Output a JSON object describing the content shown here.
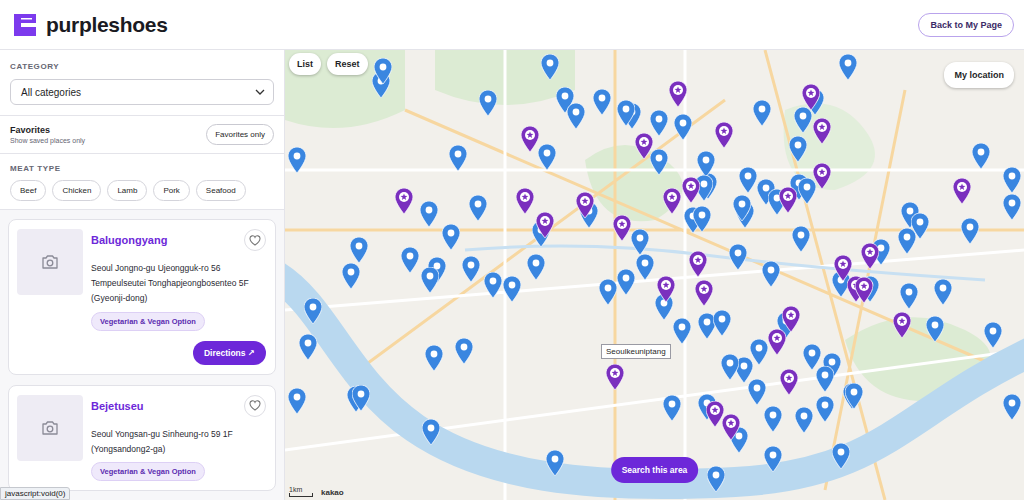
{
  "header": {
    "brand": "purpleshoes",
    "back_button": "Back to My Page"
  },
  "filters": {
    "category_label": "CATEGORY",
    "category_value": "All categories",
    "favorites_title": "Favorites",
    "favorites_hint": "Show saved places only",
    "favorites_button": "Favorites only",
    "favorites_only": false,
    "meat_type_label": "MEAT TYPE",
    "meat_types": [
      {
        "label": "Beef",
        "selected": false
      },
      {
        "label": "Chicken",
        "selected": false
      },
      {
        "label": "Lamb",
        "selected": false
      },
      {
        "label": "Pork",
        "selected": false
      },
      {
        "label": "Seafood",
        "selected": false
      }
    ]
  },
  "places": [
    {
      "name": "Balugongyang",
      "address": "Seoul Jongno-gu Ujeongguk-ro 56 Tempeulseutei Tonghapjeongbosenteo 5F (Gyeonji-dong)",
      "tag": "Vegetarian & Vegan Option",
      "favorite": false,
      "action": "Directions ↗"
    },
    {
      "name": "Bejetuseu",
      "address": "Seoul Yongsan-gu Sinheung-ro 59 1F (Yongsandong2-ga)",
      "tag": "Vegetarian & Vegan Option",
      "favorite": false
    }
  ],
  "map": {
    "buttons": [
      "List",
      "Reset"
    ],
    "my_location": "My location",
    "search_button": "Search this area",
    "scale": "1km",
    "attribution": "kakao",
    "tooltip": "Seoulkeuniptang",
    "pins": [
      {
        "kind": "standard",
        "color": "#3a86e0"
      },
      {
        "kind": "standard",
        "color": "#3a86e0"
      },
      {
        "kind": "standard",
        "color": "#3a86e0"
      },
      {
        "kind": "standard",
        "color": "#3a86e0"
      },
      {
        "kind": "standard",
        "color": "#3a86e0"
      },
      {
        "kind": "standard",
        "color": "#3a86e0"
      },
      {
        "kind": "standard",
        "color": "#3a86e0"
      },
      {
        "kind": "standard",
        "color": "#3a86e0"
      },
      {
        "kind": "standard",
        "color": "#3a86e0"
      },
      {
        "kind": "standard",
        "color": "#3a86e0"
      },
      {
        "kind": "standard",
        "color": "#3a86e0"
      },
      {
        "kind": "standard",
        "color": "#3a86e0"
      },
      {
        "kind": "standard",
        "color": "#3a86e0"
      },
      {
        "kind": "standard",
        "color": "#3a86e0"
      },
      {
        "kind": "standard",
        "color": "#3a86e0"
      },
      {
        "kind": "standard",
        "color": "#3a86e0"
      },
      {
        "kind": "standard",
        "color": "#3a86e0"
      },
      {
        "kind": "standard",
        "color": "#3a86e0"
      },
      {
        "kind": "standard",
        "color": "#3a86e0"
      },
      {
        "kind": "standard",
        "color": "#3a86e0"
      },
      {
        "kind": "standard",
        "color": "#3a86e0"
      },
      {
        "kind": "standard",
        "color": "#3a86e0"
      },
      {
        "kind": "standard",
        "color": "#3a86e0"
      },
      {
        "kind": "standard",
        "color": "#3a86e0"
      },
      {
        "kind": "standard",
        "color": "#3a86e0"
      },
      {
        "kind": "standard",
        "color": "#3a86e0"
      },
      {
        "kind": "standard",
        "color": "#3a86e0"
      },
      {
        "kind": "standard",
        "color": "#3a86e0"
      },
      {
        "kind": "standard",
        "color": "#3a86e0"
      },
      {
        "kind": "standard",
        "color": "#3a86e0"
      },
      {
        "kind": "standard",
        "color": "#3a86e0"
      },
      {
        "kind": "standard",
        "color": "#3a86e0"
      },
      {
        "kind": "standard",
        "color": "#3a86e0"
      },
      {
        "kind": "standard",
        "color": "#3a86e0"
      },
      {
        "kind": "standard",
        "color": "#3a86e0"
      },
      {
        "kind": "standard",
        "color": "#3a86e0"
      },
      {
        "kind": "standard",
        "color": "#3a86e0"
      },
      {
        "kind": "standard",
        "color": "#3a86e0"
      },
      {
        "kind": "standard",
        "color": "#3a86e0"
      },
      {
        "kind": "standard",
        "color": "#3a86e0"
      },
      {
        "kind": "standard",
        "color": "#3a86e0"
      },
      {
        "kind": "standard",
        "color": "#3a86e0"
      },
      {
        "kind": "standard",
        "color": "#3a86e0"
      },
      {
        "kind": "standard",
        "color": "#3a86e0"
      },
      {
        "kind": "standard",
        "color": "#3a86e0"
      },
      {
        "kind": "standard",
        "color": "#3a86e0"
      },
      {
        "kind": "standard",
        "color": "#3a86e0"
      },
      {
        "kind": "standard",
        "color": "#3a86e0"
      },
      {
        "kind": "standard",
        "color": "#3a86e0"
      },
      {
        "kind": "standard",
        "color": "#3a86e0"
      },
      {
        "kind": "standard",
        "color": "#3a86e0"
      },
      {
        "kind": "standard",
        "color": "#3a86e0"
      },
      {
        "kind": "standard",
        "color": "#3a86e0"
      },
      {
        "kind": "standard",
        "color": "#3a86e0"
      },
      {
        "kind": "standard",
        "color": "#3a86e0"
      },
      {
        "kind": "standard",
        "color": "#3a86e0"
      },
      {
        "kind": "standard",
        "color": "#3a86e0"
      },
      {
        "kind": "standard",
        "color": "#3a86e0"
      },
      {
        "kind": "standard",
        "color": "#3a86e0"
      },
      {
        "kind": "standard",
        "color": "#3a86e0"
      },
      {
        "kind": "standard",
        "color": "#3a86e0"
      },
      {
        "kind": "standard",
        "color": "#3a86e0"
      },
      {
        "kind": "standard",
        "color": "#3a86e0"
      },
      {
        "kind": "standard",
        "color": "#3a86e0"
      },
      {
        "kind": "standard",
        "color": "#3a86e0"
      },
      {
        "kind": "standard",
        "color": "#3a86e0"
      },
      {
        "kind": "standard",
        "color": "#3a86e0"
      },
      {
        "kind": "standard",
        "color": "#3a86e0"
      },
      {
        "kind": "standard",
        "color": "#3a86e0"
      },
      {
        "kind": "standard",
        "color": "#3a86e0"
      },
      {
        "kind": "standard",
        "color": "#3a86e0"
      },
      {
        "kind": "standard",
        "color": "#3a86e0"
      },
      {
        "kind": "standard",
        "color": "#3a86e0"
      },
      {
        "kind": "standard",
        "color": "#3a86e0"
      },
      {
        "kind": "standard",
        "color": "#3a86e0"
      },
      {
        "kind": "standard",
        "color": "#3a86e0"
      },
      {
        "kind": "standard",
        "color": "#3a86e0"
      },
      {
        "kind": "standard",
        "color": "#3a86e0"
      },
      {
        "kind": "standard",
        "color": "#3a86e0"
      },
      {
        "kind": "standard",
        "color": "#3a86e0"
      },
      {
        "kind": "standard",
        "color": "#3a86e0"
      },
      {
        "kind": "standard",
        "color": "#3a86e0"
      },
      {
        "kind": "standard",
        "color": "#3a86e0"
      },
      {
        "kind": "standard",
        "color": "#3a86e0"
      },
      {
        "kind": "standard",
        "color": "#3a86e0"
      },
      {
        "kind": "standard",
        "color": "#3a86e0"
      },
      {
        "kind": "standard",
        "color": "#3a86e0"
      },
      {
        "kind": "standard",
        "color": "#3a86e0"
      },
      {
        "kind": "standard",
        "color": "#3a86e0"
      },
      {
        "kind": "standard",
        "color": "#3a86e0"
      },
      {
        "kind": "standard",
        "color": "#3a86e0"
      },
      {
        "kind": "standard",
        "color": "#3a86e0"
      },
      {
        "kind": "standard",
        "color": "#3a86e0"
      },
      {
        "kind": "standard",
        "color": "#3a86e0"
      },
      {
        "kind": "standard",
        "color": "#3a86e0"
      },
      {
        "kind": "standard",
        "color": "#3a86e0"
      },
      {
        "kind": "standard",
        "color": "#3a86e0"
      },
      {
        "kind": "standard",
        "color": "#3a86e0"
      },
      {
        "kind": "standard",
        "color": "#3a86e0"
      },
      {
        "kind": "standard",
        "color": "#3a86e0"
      },
      {
        "kind": "vegan",
        "color": "#7a2fbe"
      },
      {
        "kind": "vegan",
        "color": "#7a2fbe"
      },
      {
        "kind": "vegan",
        "color": "#7a2fbe"
      },
      {
        "kind": "vegan",
        "color": "#7a2fbe"
      },
      {
        "kind": "vegan",
        "color": "#7a2fbe"
      },
      {
        "kind": "vegan",
        "color": "#7a2fbe"
      },
      {
        "kind": "vegan",
        "color": "#7a2fbe"
      },
      {
        "kind": "vegan",
        "color": "#7a2fbe"
      },
      {
        "kind": "vegan",
        "color": "#7a2fbe"
      },
      {
        "kind": "vegan",
        "color": "#7a2fbe"
      },
      {
        "kind": "vegan",
        "color": "#7a2fbe"
      },
      {
        "kind": "vegan",
        "color": "#7a2fbe"
      },
      {
        "kind": "vegan",
        "color": "#7a2fbe"
      },
      {
        "kind": "vegan",
        "color": "#7a2fbe"
      },
      {
        "kind": "vegan",
        "color": "#7a2fbe"
      },
      {
        "kind": "vegan",
        "color": "#7a2fbe"
      },
      {
        "kind": "vegan",
        "color": "#7a2fbe"
      },
      {
        "kind": "vegan",
        "color": "#7a2fbe"
      },
      {
        "kind": "vegan",
        "color": "#7a2fbe"
      },
      {
        "kind": "vegan",
        "color": "#7a2fbe"
      },
      {
        "kind": "vegan",
        "color": "#7a2fbe"
      },
      {
        "kind": "vegan",
        "color": "#7a2fbe"
      },
      {
        "kind": "vegan",
        "color": "#7a2fbe"
      },
      {
        "kind": "vegan",
        "color": "#7a2fbe"
      },
      {
        "kind": "vegan",
        "color": "#7a2fbe"
      },
      {
        "kind": "vegan",
        "color": "#7a2fbe"
      },
      {
        "kind": "vegan",
        "color": "#7a2fbe"
      },
      {
        "kind": "vegan",
        "color": "#7a2fbe"
      },
      {
        "kind": "vegan",
        "color": "#7a2fbe"
      },
      {
        "kind": "vegan",
        "color": "#7a2fbe"
      }
    ]
  },
  "status_bar": "javascript:void(0)"
}
